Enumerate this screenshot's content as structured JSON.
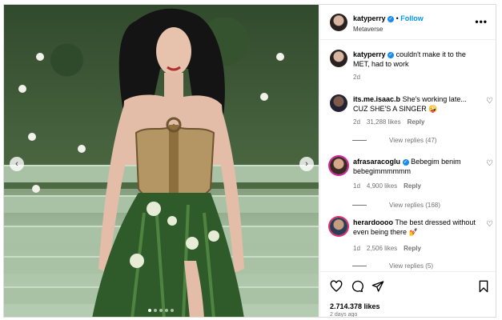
{
  "header": {
    "username": "katyperry",
    "follow_sep": "•",
    "follow_label": "Follow",
    "subtitle": "Metaverse",
    "more_label": "•••"
  },
  "caption": {
    "username": "katyperry",
    "text": "couldn't make it to the MET, had to work",
    "time": "2d"
  },
  "comments": [
    {
      "username": "its.me.isaac.b",
      "text": "She's working late... CUZ SHE'S A SINGER 🤪",
      "time": "2d",
      "likes": "31,288 likes",
      "reply": "Reply",
      "view_replies": "View replies (47)",
      "verified": false
    },
    {
      "username": "afrasaracoglu",
      "text": "Bebegim benim bebegimmmmmm",
      "time": "1d",
      "likes": "4,900 likes",
      "reply": "Reply",
      "view_replies": "View replies (168)",
      "verified": true
    },
    {
      "username": "herardoooo",
      "text": "The best dressed without even being there 💅",
      "time": "1d",
      "likes": "2,506 likes",
      "reply": "Reply",
      "view_replies": "View replies (5)",
      "verified": false
    }
  ],
  "post": {
    "likes": "2.714.378 likes",
    "time_ago": "2 days ago"
  },
  "colors": {
    "follow": "#0095f6",
    "verified": "#1a8cf0",
    "muted": "#737373"
  },
  "icons": {
    "nav_left": "‹",
    "nav_right": "›",
    "heart": "♡"
  }
}
